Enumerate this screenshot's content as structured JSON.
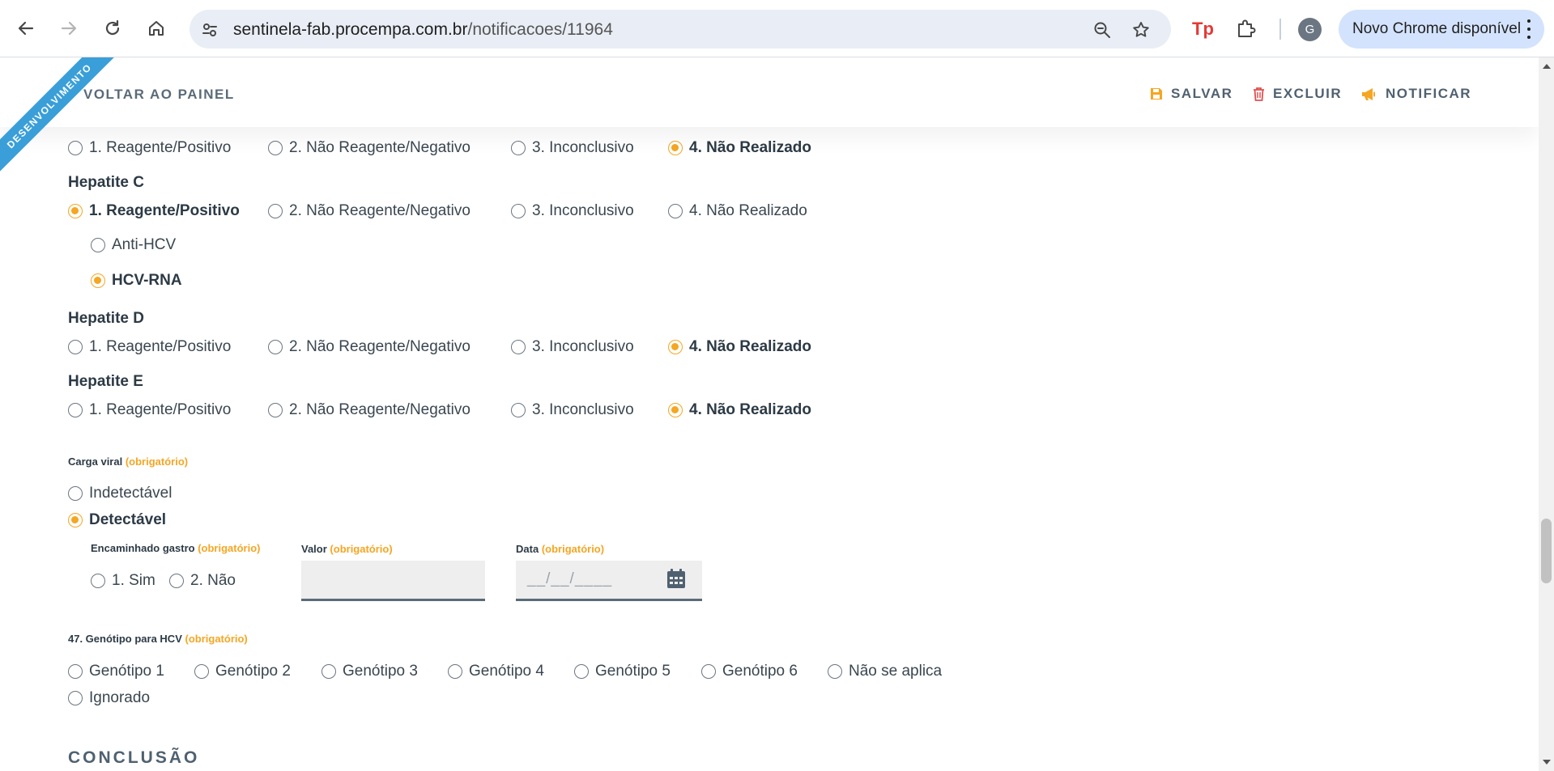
{
  "browser": {
    "url_domain": "sentinela-fab.procempa.com.br",
    "url_path": "/notificacoes/11964",
    "update_label": "Novo Chrome disponível",
    "avatar_letter": "G"
  },
  "ribbon": "DESENVOLVIMENTO",
  "topbar": {
    "back_label": "VOLTAR AO PAINEL",
    "save_label": "SALVAR",
    "delete_label": "EXCLUIR",
    "notify_label": "NOTIFICAR"
  },
  "colors": {
    "accent": "#f5a623",
    "ribbon": "#3a9fd8",
    "delete": "#e05050"
  },
  "result_options": [
    "1. Reagente/Positivo",
    "2. Não Reagente/Negativo",
    "3. Inconclusivo",
    "4. Não Realizado"
  ],
  "hepatitis": [
    {
      "title": "",
      "selected": 3
    },
    {
      "title": "Hepatite C",
      "selected": 0
    },
    {
      "title": "Hepatite D",
      "selected": 3
    },
    {
      "title": "Hepatite E",
      "selected": 3
    }
  ],
  "hcv_sub": {
    "options": [
      "Anti-HCV",
      "HCV-RNA"
    ],
    "selected": 1
  },
  "carga_viral": {
    "label": "Carga viral",
    "required": "(obrigatório)",
    "options": [
      "Indetectável",
      "Detectável"
    ],
    "selected": 1
  },
  "encaminhado": {
    "label": "Encaminhado gastro",
    "required": "(obrigatório)",
    "options": [
      "1. Sim",
      "2. Não"
    ]
  },
  "valor": {
    "label": "Valor",
    "required": "(obrigatório)",
    "value": ""
  },
  "data": {
    "label": "Data",
    "required": "(obrigatório)",
    "placeholder": "__/__/____"
  },
  "genotipo": {
    "label": "47. Genótipo para HCV",
    "required": "(obrigatório)",
    "options": [
      "Genótipo 1",
      "Genótipo 2",
      "Genótipo 3",
      "Genótipo 4",
      "Genótipo 5",
      "Genótipo 6",
      "Não se aplica",
      "Ignorado"
    ]
  },
  "conclusao_title": "CONCLUSÃO"
}
